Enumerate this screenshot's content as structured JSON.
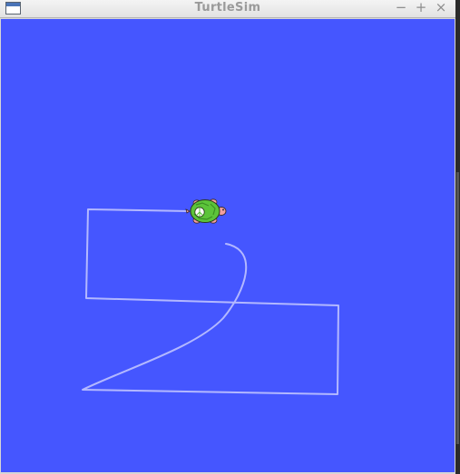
{
  "window": {
    "title": "TurtleSim",
    "buttons": {
      "minimize": "−",
      "maximize": "+",
      "close": "×"
    }
  },
  "colors": {
    "canvas_background": "#4556ff",
    "pen": "#b3b8ff",
    "turtle_shell": "#5cc43a",
    "turtle_skin": "#f3a0a0"
  },
  "turtle": {
    "icon": "turtle-icon",
    "heading": "east"
  }
}
